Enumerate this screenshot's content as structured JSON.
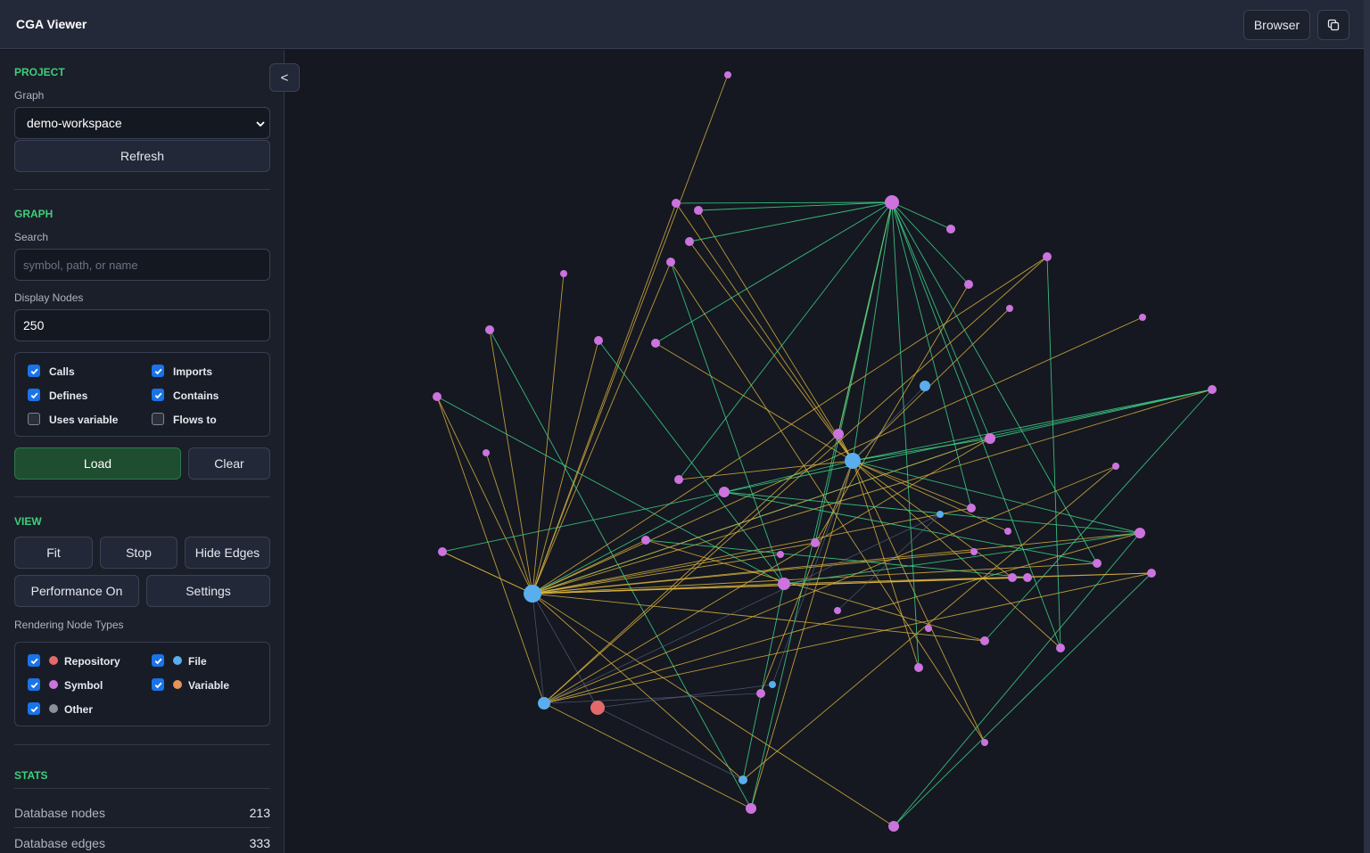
{
  "app": {
    "title": "CGA Viewer"
  },
  "topbar": {
    "browser_label": "Browser",
    "copy_icon": "copy-icon"
  },
  "sidebar": {
    "collapse_label": "<",
    "project": {
      "title": "PROJECT",
      "graph_label": "Graph",
      "graph_value": "demo-workspace",
      "refresh_label": "Refresh"
    },
    "graph": {
      "title": "GRAPH",
      "search_label": "Search",
      "search_placeholder": "symbol, path, or name",
      "display_nodes_label": "Display Nodes",
      "display_nodes_value": "250",
      "edge_types": [
        {
          "label": "Calls",
          "checked": true
        },
        {
          "label": "Imports",
          "checked": true
        },
        {
          "label": "Defines",
          "checked": true
        },
        {
          "label": "Contains",
          "checked": true
        },
        {
          "label": "Uses variable",
          "checked": false
        },
        {
          "label": "Flows to",
          "checked": false
        }
      ],
      "load_label": "Load",
      "clear_label": "Clear"
    },
    "view": {
      "title": "VIEW",
      "fit_label": "Fit",
      "stop_label": "Stop",
      "hide_edges_label": "Hide Edges",
      "performance_label": "Performance On",
      "settings_label": "Settings",
      "node_types_label": "Rendering Node Types",
      "node_types": [
        {
          "label": "Repository",
          "checked": true,
          "color": "#e36a6a"
        },
        {
          "label": "File",
          "checked": true,
          "color": "#5aaeee"
        },
        {
          "label": "Symbol",
          "checked": true,
          "color": "#cc73de"
        },
        {
          "label": "Variable",
          "checked": true,
          "color": "#e3955a"
        },
        {
          "label": "Other",
          "checked": true,
          "color": "#8a8f9c"
        }
      ]
    },
    "stats": {
      "title": "STATS",
      "rows": [
        {
          "label": "Database nodes",
          "value": "213"
        },
        {
          "label": "Database edges",
          "value": "333"
        }
      ]
    }
  },
  "colors": {
    "accent_green": "#3ecf7a",
    "edge_calls": "#d8b13c",
    "edge_contains": "#3ed68a",
    "edge_other": "#5c6a8c"
  }
}
